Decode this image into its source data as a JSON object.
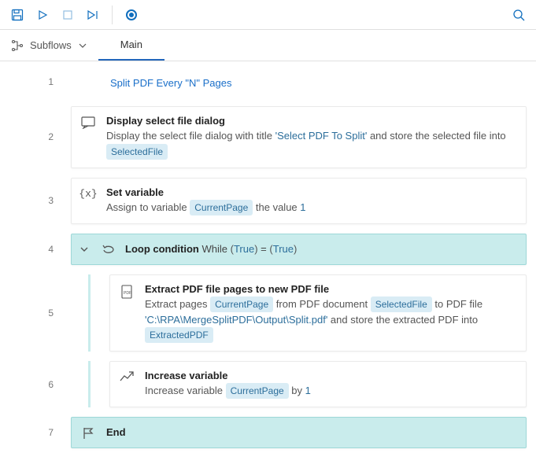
{
  "toolbar": {
    "save_title": "Save",
    "run_title": "Run",
    "stop_title": "Stop",
    "next_title": "Run next action",
    "record_title": "Recorder",
    "search_title": "Search"
  },
  "tabs": {
    "subflows_label": "Subflows",
    "main_label": "Main"
  },
  "flow": {
    "title": "Split PDF Every \"N\" Pages",
    "rows": [
      {
        "num": "1"
      },
      {
        "num": "2"
      },
      {
        "num": "3"
      },
      {
        "num": "4"
      },
      {
        "num": "5"
      },
      {
        "num": "6"
      },
      {
        "num": "7"
      }
    ]
  },
  "actions": {
    "display_dialog": {
      "title": "Display select file dialog",
      "desc_pre": "Display the select file dialog with title ",
      "dialog_title": "'Select PDF To Split'",
      "desc_mid": " and store the selected file into ",
      "out_var": "SelectedFile"
    },
    "set_var": {
      "title": "Set variable",
      "desc_pre": "Assign to variable ",
      "var": "CurrentPage",
      "desc_mid": " the value ",
      "value": "1"
    },
    "loop": {
      "title": "Loop condition",
      "while_label": " While ",
      "lhs": "True",
      "op": " = ",
      "rhs": "True"
    },
    "extract": {
      "title": "Extract PDF file pages to new PDF file",
      "d1": "Extract pages ",
      "pages_var": "CurrentPage",
      "d2": " from PDF document ",
      "doc_var": "SelectedFile",
      "d3": " to PDF file ",
      "path": "'C:\\RPA\\MergeSplitPDF\\Output\\Split.pdf'",
      "d4": " and store the extracted PDF into ",
      "out_var": "ExtractedPDF"
    },
    "increase": {
      "title": "Increase variable",
      "d1": "Increase variable ",
      "var": "CurrentPage",
      "d2": " by ",
      "value": "1"
    },
    "end": {
      "title": "End"
    }
  }
}
